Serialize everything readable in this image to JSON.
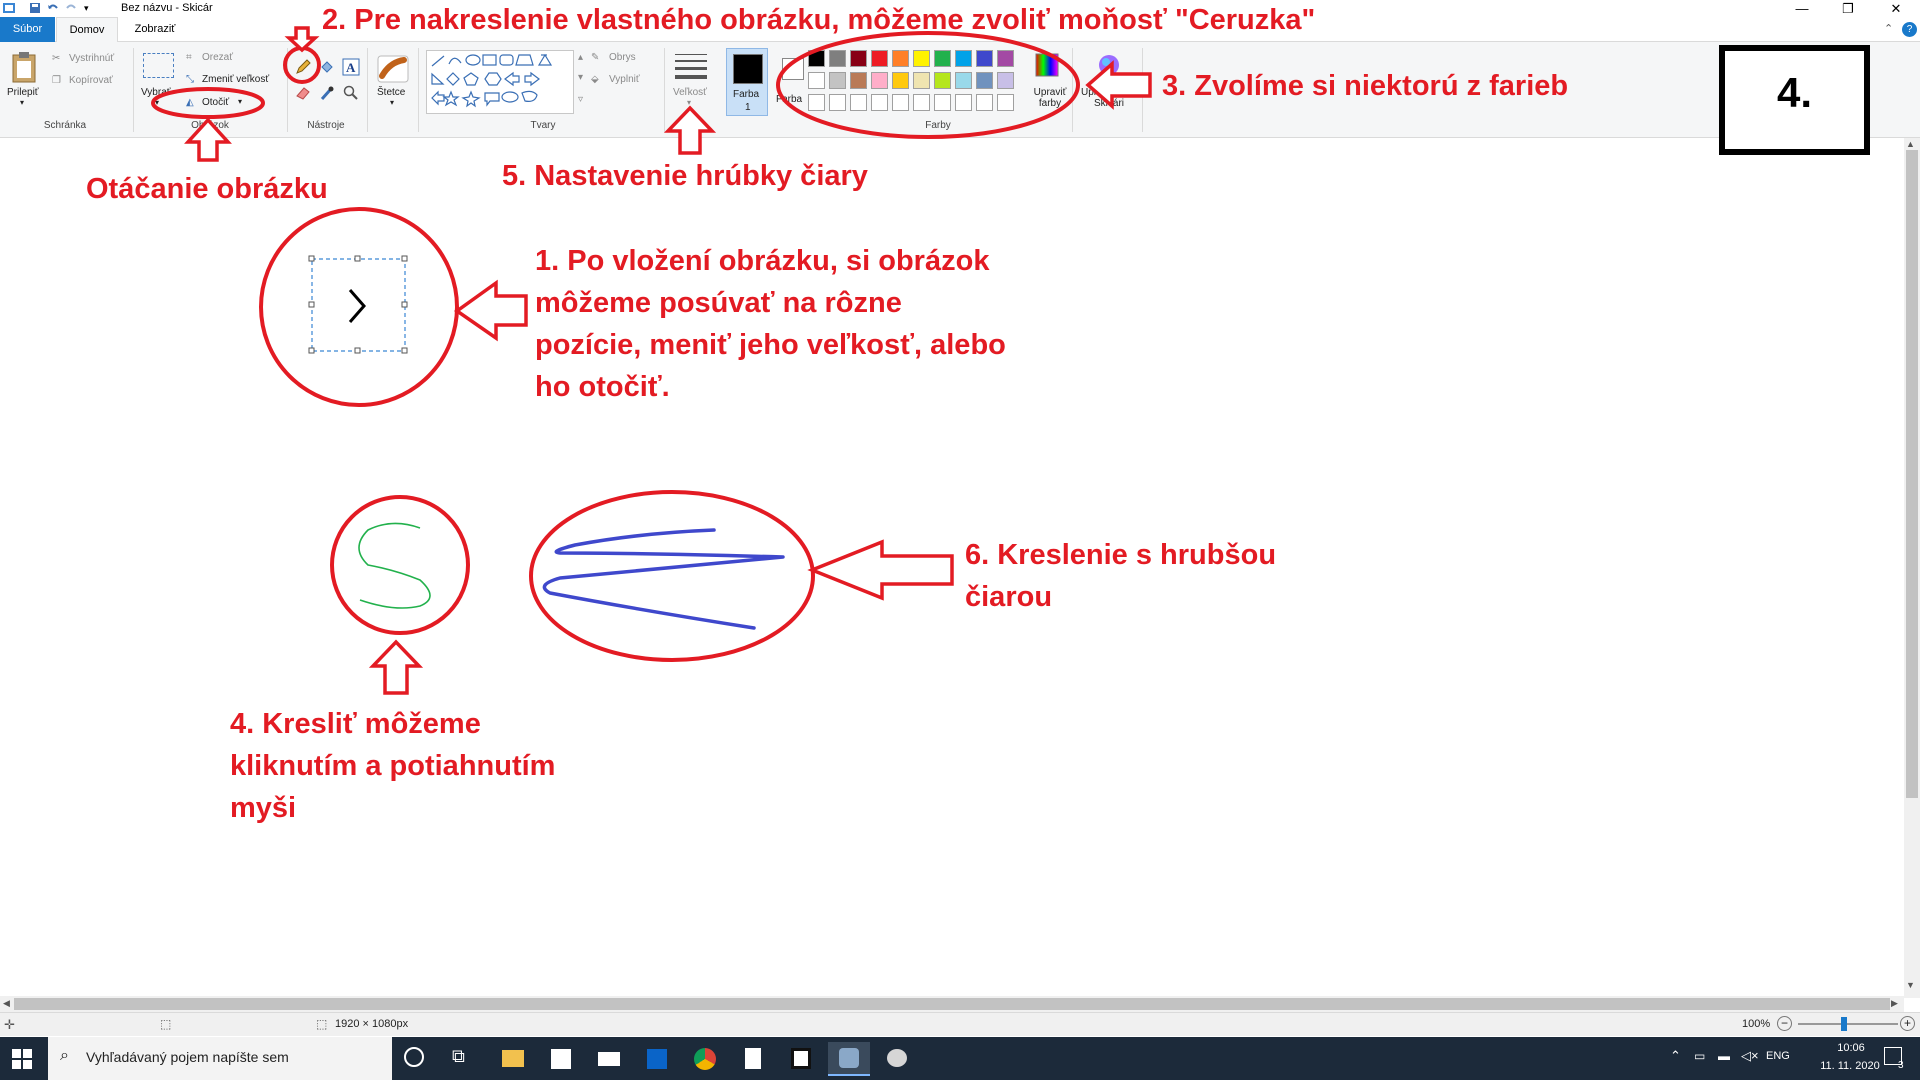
{
  "window": {
    "title": "Bez názvu - Skicár",
    "minimize_icon": "minimize-icon",
    "maximize_icon": "restore-icon",
    "close_icon": "close-icon"
  },
  "tabs": [
    {
      "label": "Súbor"
    },
    {
      "label": "Domov"
    },
    {
      "label": "Zobraziť"
    }
  ],
  "ribbon": {
    "clipboard": {
      "paste": "Prilepiť",
      "cut": "Vystrihnúť",
      "copy": "Kopírovať",
      "group": "Schránka"
    },
    "image": {
      "select": "Vybrať",
      "crop": "Orezať",
      "resize": "Zmeniť veľkosť",
      "rotate": "Otočiť",
      "group": "Obrázok"
    },
    "tools": {
      "group": "Nástroje"
    },
    "brushes": {
      "label": "Štetce"
    },
    "shapes": {
      "outline": "Obrys",
      "fill": "Vyplniť",
      "group": "Tvary"
    },
    "size": {
      "label": "Veľkosť"
    },
    "color1": {
      "label": "Farba",
      "sub": "1"
    },
    "color2": {
      "label": "Farba",
      "sub": "2"
    },
    "colors": {
      "group": "Farby",
      "edit": "Upraviť farby"
    },
    "paint3d": {
      "label": "Upraviť v 3D Skicári"
    }
  },
  "palette": {
    "row1": [
      "#000000",
      "#7f7f7f",
      "#880015",
      "#ed1c24",
      "#ff7f27",
      "#fff200",
      "#22b14c",
      "#00a2e8",
      "#3f48cc",
      "#a349a4"
    ],
    "row2": [
      "#ffffff",
      "#c3c3c3",
      "#b97a57",
      "#ffaec9",
      "#ffc90e",
      "#efe4b0",
      "#b5e61d",
      "#99d9ea",
      "#7092be",
      "#c8bfe7"
    ],
    "row3": [
      "#ffffff",
      "#ffffff",
      "#ffffff",
      "#ffffff",
      "#ffffff",
      "#ffffff",
      "#ffffff",
      "#ffffff",
      "#ffffff",
      "#ffffff"
    ]
  },
  "annotations": {
    "a2": "2. Pre nakreslenie vlastného obrázku, môžeme zvoliť moňosť \"Ceruzka\"",
    "a3": "3. Zvolíme si niektorú z farieb",
    "a4box": "4.",
    "a5": "5. Nastavenie hrúbky čiary",
    "rotate": "Otáčanie obrázku",
    "a1_l1": "1. Po vložení obrázku, si obrázok",
    "a1_l2": "môžeme posúvať na rôzne",
    "a1_l3": "pozície, meniť jeho veľkosť, alebo",
    "a1_l4": "ho otočiť.",
    "a6_l1": "6. Kreslenie s hrubšou",
    "a6_l2": "čiarou",
    "a4_l1": "4. Kresliť môžeme",
    "a4_l2": "kliknutím a potiahnutím",
    "a4_l3": "myši"
  },
  "status": {
    "dimensions": "1920 × 1080px",
    "zoom": "100%"
  },
  "taskbar": {
    "search_placeholder": "Vyhľadávaný pojem napíšte sem",
    "language": "ENG",
    "time": "10:06",
    "date": "11. 11. 2020",
    "notifications": "3"
  },
  "colors": {
    "annotation_red": "#e31b23",
    "accent_blue": "#1979ca",
    "taskbar": "#1c2a3a"
  }
}
